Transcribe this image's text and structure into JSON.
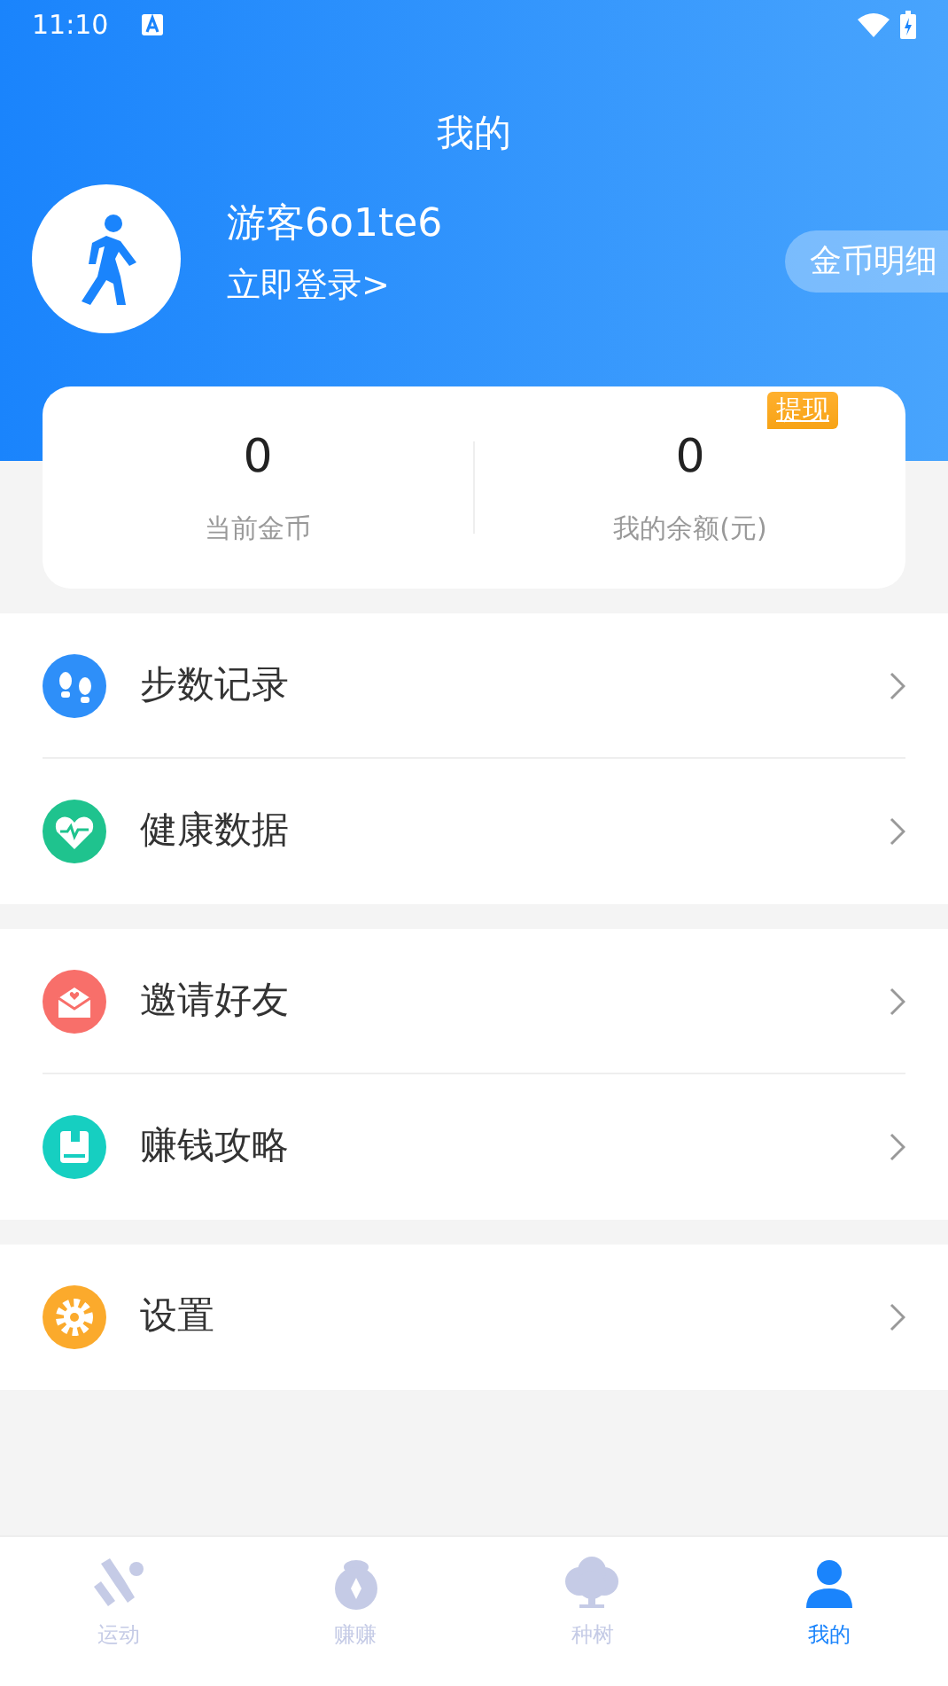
{
  "status_bar": {
    "time": "11:10"
  },
  "header": {
    "title": "我的",
    "user_name": "游客6o1te6",
    "login_link": "立即登录>",
    "coin_detail_button": "金币明细"
  },
  "stats": [
    {
      "value": "0",
      "label": "当前金币"
    },
    {
      "value": "0",
      "label": "我的余额(元)",
      "badge": "提现"
    }
  ],
  "menu_groups": [
    [
      {
        "kind": "steps",
        "label": "步数记录"
      },
      {
        "kind": "health",
        "label": "健康数据"
      }
    ],
    [
      {
        "kind": "invite",
        "label": "邀请好友"
      },
      {
        "kind": "guide",
        "label": "赚钱攻略"
      }
    ],
    [
      {
        "kind": "settings",
        "label": "设置"
      }
    ]
  ],
  "tabs": [
    {
      "kind": "sport",
      "label": "运动",
      "selected": false
    },
    {
      "kind": "earn",
      "label": "赚赚",
      "selected": false
    },
    {
      "kind": "tree",
      "label": "种树",
      "selected": false
    },
    {
      "kind": "me",
      "label": "我的",
      "selected": true
    }
  ]
}
